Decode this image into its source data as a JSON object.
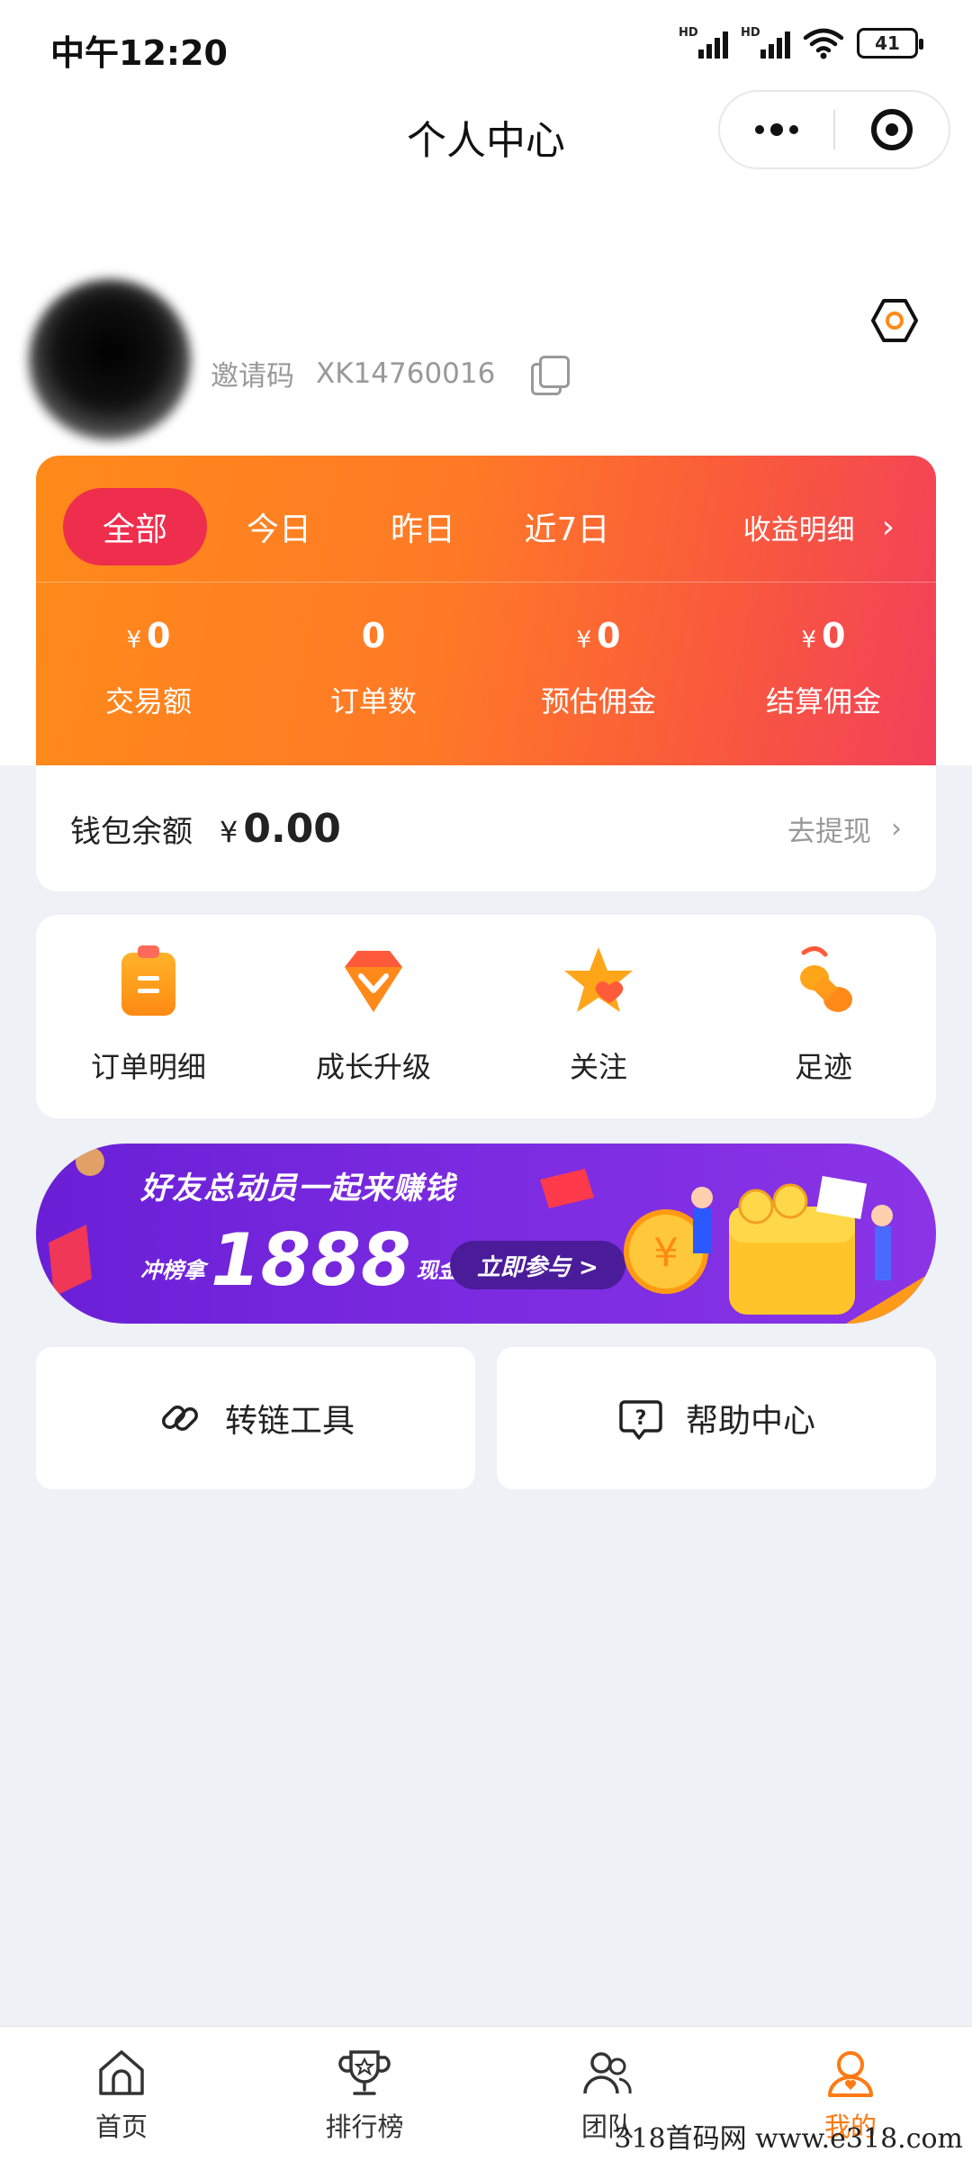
{
  "status_bar": {
    "time": "中午12:20",
    "battery": "41",
    "signal_label": "HD"
  },
  "header": {
    "title": "个人中心"
  },
  "profile": {
    "invite_label": "邀请码",
    "invite_code": "XK14760016"
  },
  "earnings": {
    "tabs": [
      {
        "label": "全部",
        "active": true
      },
      {
        "label": "今日",
        "active": false
      },
      {
        "label": "昨日",
        "active": false
      },
      {
        "label": "近7日",
        "active": false
      }
    ],
    "detail_link": "收益明细",
    "currency": "¥",
    "stats": [
      {
        "value": "0",
        "label": "交易额",
        "currency": true
      },
      {
        "value": "0",
        "label": "订单数",
        "currency": false
      },
      {
        "value": "0",
        "label": "预估佣金",
        "currency": true
      },
      {
        "value": "0",
        "label": "结算佣金",
        "currency": true
      }
    ]
  },
  "wallet": {
    "label": "钱包余额",
    "currency": "¥",
    "amount": "0.00",
    "action": "去提现"
  },
  "quick_actions": [
    {
      "label": "订单明细",
      "icon": "clipboard-icon"
    },
    {
      "label": "成长升级",
      "icon": "diamond-icon"
    },
    {
      "label": "关注",
      "icon": "star-icon"
    },
    {
      "label": "足迹",
      "icon": "footprint-icon"
    }
  ],
  "banner": {
    "title": "好友总动员一起来赚钱",
    "prefix": "冲榜拿",
    "amount": "1888",
    "suffix": "现金",
    "button": "立即参与 >"
  },
  "tools": [
    {
      "label": "转链工具",
      "icon": "link-icon"
    },
    {
      "label": "帮助中心",
      "icon": "help-icon"
    }
  ],
  "tabbar": [
    {
      "label": "首页",
      "icon": "home-icon",
      "active": false
    },
    {
      "label": "排行榜",
      "icon": "trophy-icon",
      "active": false
    },
    {
      "label": "团队",
      "icon": "team-icon",
      "active": false
    },
    {
      "label": "我的",
      "icon": "profile-icon",
      "active": true
    }
  ],
  "colors": {
    "accent": "#ff7a12",
    "active_tab": "#ef2d4d",
    "banner": "#7b2be0",
    "page_bg": "#eef1f5"
  },
  "watermark": "318首码网  www.e318.com"
}
